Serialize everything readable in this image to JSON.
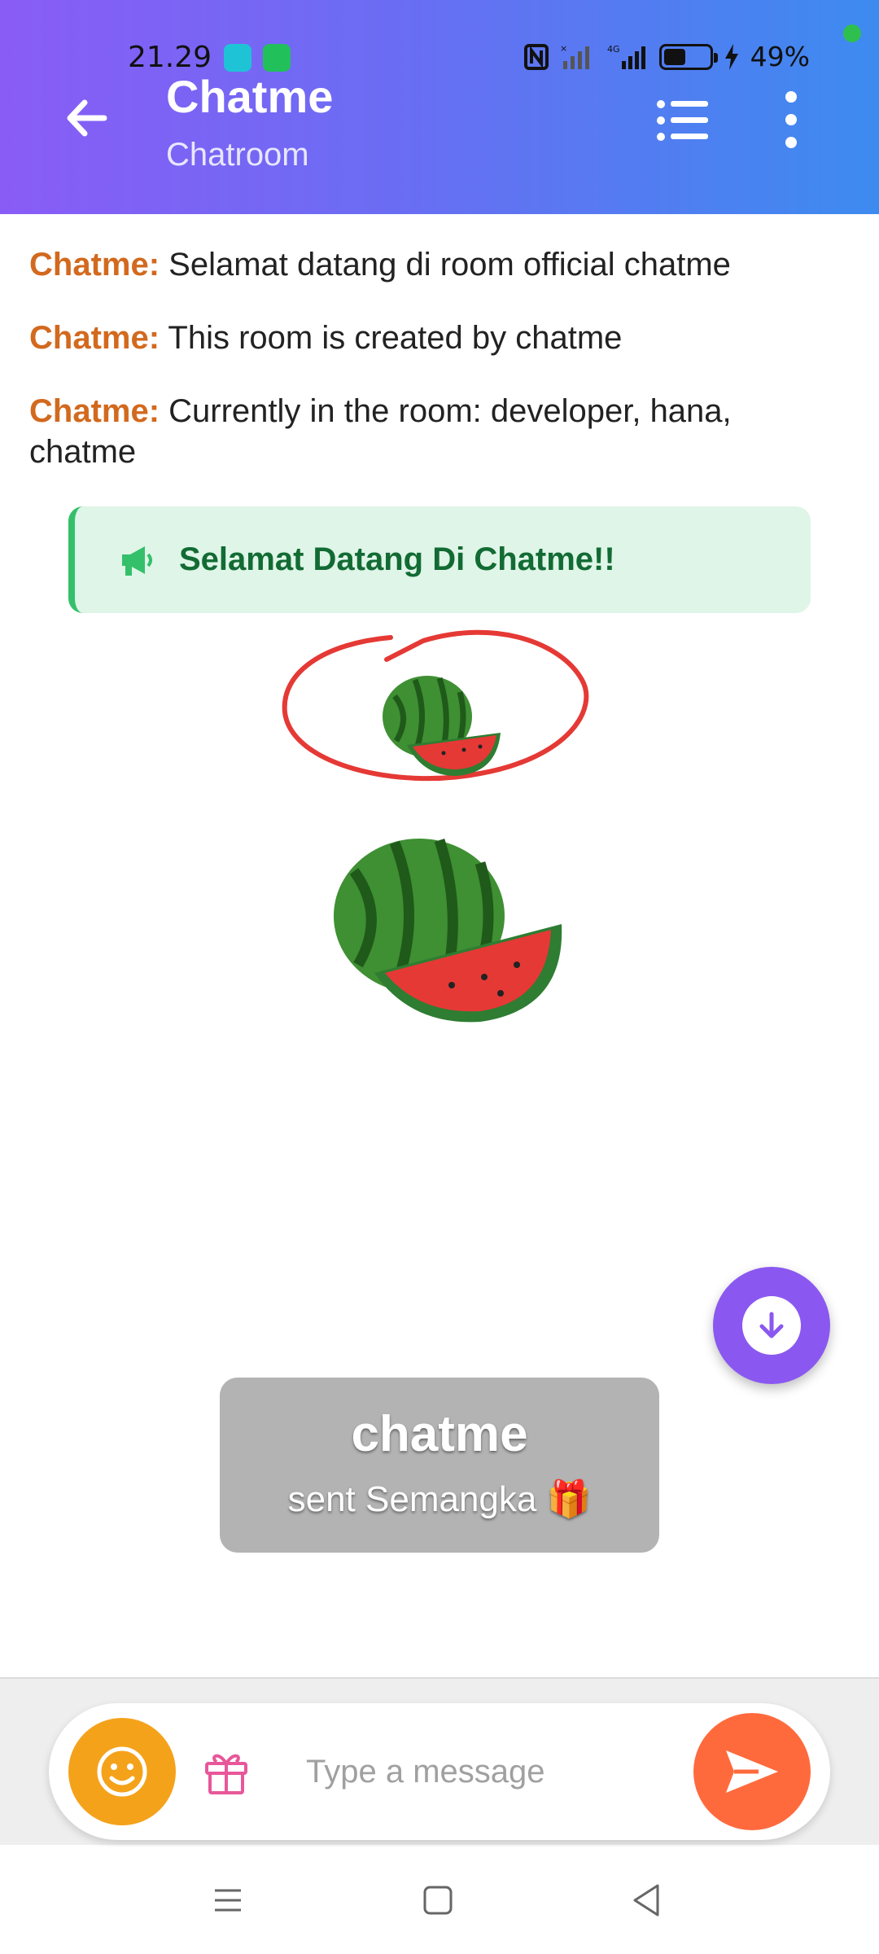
{
  "status_bar": {
    "time": "21.29",
    "battery_percent": "49%",
    "battery_level": 0.49
  },
  "header": {
    "title": "Chatme",
    "subtitle": "Chatroom"
  },
  "messages": [
    {
      "sender": "Chatme:",
      "text": "Selamat datang di room official chatme"
    },
    {
      "sender": "Chatme:",
      "text": "This room is created by chatme"
    },
    {
      "sender": "Chatme:",
      "text": "Currently in the room: developer, hana, chatme"
    }
  ],
  "announcement": {
    "text": "Selamat Datang Di Chatme!!",
    "icon": "megaphone-icon"
  },
  "gift_toast": {
    "name": "chatme",
    "message": "sent Semangka 🎁"
  },
  "composer": {
    "placeholder": "Type a message",
    "value": ""
  },
  "colors": {
    "header_start": "#8a5cf6",
    "header_end": "#3d8bf0",
    "sender": "#d2691e",
    "announce_bg": "#dff5e8",
    "announce_text": "#126b33",
    "fab": "#8a58f0",
    "emoji_button": "#f5a21b",
    "send_button": "#ff6a3d"
  }
}
